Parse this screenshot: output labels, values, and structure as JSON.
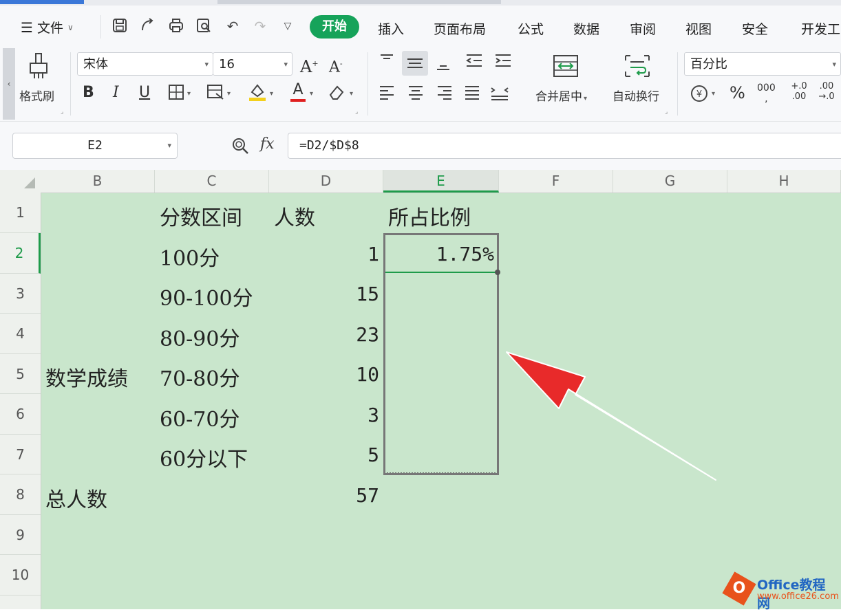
{
  "menu": {
    "file_label": "文件",
    "tabs": [
      "开始",
      "插入",
      "页面布局",
      "公式",
      "数据",
      "审阅",
      "视图",
      "安全",
      "开发工"
    ],
    "active_tab": "开始"
  },
  "ribbon": {
    "format_painter": "格式刷",
    "font_name": "宋体",
    "font_size": "16",
    "merge_center": "合并居中",
    "wrap_text": "自动换行",
    "number_format": "百分比",
    "percent_symbol": "%",
    "thousands": "000",
    "dec_increase": "+.0 .00",
    "dec_decrease": ".00 →.0",
    "bold": "B",
    "italic": "I",
    "underline": "U",
    "font_color_letter": "A",
    "grow_font": "A",
    "shrink_font": "A"
  },
  "formula_bar": {
    "name_box": "E2",
    "fx_label": "fx",
    "formula": "=D2/$D$8"
  },
  "sheet": {
    "columns": [
      "B",
      "C",
      "D",
      "E",
      "F",
      "G",
      "H"
    ],
    "active_column": "E",
    "rows": [
      "1",
      "2",
      "3",
      "4",
      "5",
      "6",
      "7",
      "8",
      "9",
      "10"
    ],
    "active_row": "2",
    "cells": {
      "C1": "分数区间",
      "D1": "人数",
      "E1": "所占比例",
      "C2": "100分",
      "D2": "1",
      "E2": "1.75%",
      "C3": "90-100分",
      "D3": "15",
      "C4": "80-90分",
      "D4": "23",
      "B5": "数学成绩",
      "C5": "70-80分",
      "D5": "10",
      "C6": "60-70分",
      "D6": "3",
      "C7": "60分以下",
      "D7": "5",
      "B8": "总人数",
      "D8": "57"
    }
  },
  "watermark": {
    "brand": "Office教程网",
    "url": "www.office26.com",
    "logo_letter": "O"
  },
  "colors": {
    "accent_green": "#16a35a",
    "sheet_bg": "#c9e6cc",
    "arrow_red": "#e82a2a"
  }
}
